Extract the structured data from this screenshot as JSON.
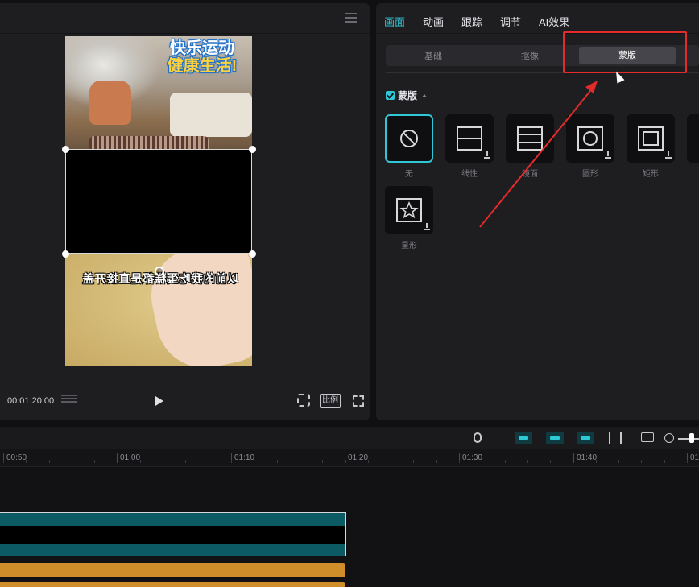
{
  "player": {
    "timecode": "00:01:20:00",
    "ratio_label": "比例",
    "video_title_line1": "快乐运动",
    "video_title_line2": "健康生活!",
    "subtitle": "以前的我吃蛋糕都是直接开盖"
  },
  "inspector": {
    "tabs": [
      "画面",
      "动画",
      "跟踪",
      "调节",
      "AI效果"
    ],
    "active_tab": "画面",
    "subtabs": [
      "基础",
      "抠像",
      "蒙版"
    ],
    "active_subtab": "蒙版",
    "section_title": "蒙版",
    "masks": [
      {
        "label": "无",
        "icon": "none-icon",
        "selected": true
      },
      {
        "label": "线性",
        "icon": "linear-mask-icon"
      },
      {
        "label": "镜面",
        "icon": "mirror-mask-icon"
      },
      {
        "label": "圆形",
        "icon": "circle-mask-icon"
      },
      {
        "label": "矩形",
        "icon": "rectangle-mask-icon"
      },
      {
        "label": "星形",
        "icon": "star-mask-icon"
      }
    ]
  },
  "timeline": {
    "ruler_labels": [
      "00:50",
      "01:00",
      "01:10",
      "01:20",
      "01:30",
      "01:40",
      "01"
    ]
  },
  "colors": {
    "accent": "#2ec8d6",
    "highlight": "#e22b2b",
    "video_clip": "#0c5a63",
    "audio_clip": "#d08e2a"
  }
}
